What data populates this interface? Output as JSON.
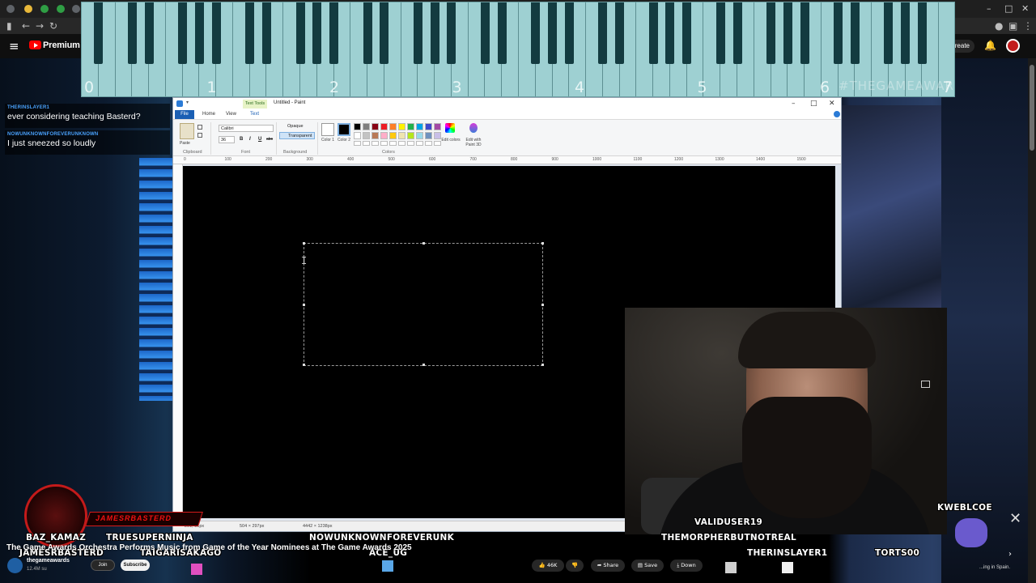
{
  "browser": {
    "window_controls": {
      "minimize": "–",
      "maximize": "□",
      "close": "✕"
    },
    "nav": {
      "back": "←",
      "forward": "→",
      "reload": "↻"
    }
  },
  "youtube_header": {
    "menu_icon": "≡",
    "brand_label": "Premium",
    "create_label": "Create",
    "bell_icon": "🔔"
  },
  "piano": {
    "octave_labels": [
      "0",
      "1",
      "2",
      "3",
      "4",
      "5",
      "6",
      "7"
    ],
    "watermark": "#THEGAMEAWARDS"
  },
  "chat": [
    {
      "user": "THERINSLAYER1",
      "message": "ever considering teaching Basterd?"
    },
    {
      "user": "NOWUNKNOWNFOREVERUNKNOWN",
      "message": "I just sneezed so loudly"
    }
  ],
  "paint": {
    "contextual_tab": "Text Tools",
    "title": "Untitled - Paint",
    "window_controls": {
      "minimize": "–",
      "maximize": "□",
      "close": "✕"
    },
    "tabs": [
      "File",
      "Home",
      "View",
      "Text"
    ],
    "clipboard_group": "Clipboard",
    "paste_label": "Paste",
    "font_group": "Font",
    "font_name": "Calibri",
    "font_size": "36",
    "format_buttons": [
      "B",
      "I",
      "U",
      "abc"
    ],
    "background_group": "Background",
    "background_options": [
      "Opaque",
      "Transparent"
    ],
    "color1_label": "Color 1",
    "color2_label": "Color 2",
    "colors_group": "Colors",
    "edit_colors": "Edit colors",
    "edit_paint3d": "Edit with Paint 3D",
    "ruler_marks": [
      "0",
      "100",
      "200",
      "300",
      "400",
      "500",
      "600",
      "700",
      "800",
      "900",
      "1000",
      "1100",
      "1200",
      "1300",
      "1400",
      "1500"
    ],
    "status": {
      "cursor": "291, 81px",
      "selection": "504 × 297px",
      "canvas": "4442 × 1238px"
    },
    "palette": [
      "#000000",
      "#7f7f7f",
      "#880015",
      "#ed1c24",
      "#ff7f27",
      "#fff200",
      "#22b14c",
      "#00a2e8",
      "#3f48cc",
      "#a349a4",
      "#ffffff",
      "#c3c3c3",
      "#b97a57",
      "#ffaec9",
      "#ffc90e",
      "#efe4b0",
      "#b5e61d",
      "#99d9ea",
      "#7092be",
      "#c8bfe7"
    ]
  },
  "stream": {
    "banner": "JAMESRBASTERD",
    "viewers": [
      "BAZ_KAMAZ",
      "TRUESUPERNINJA",
      "NOWUNKNOWNFOREVERUNK",
      "JAMESRBASTERD",
      "TAIGARISAKAGO",
      "ACE_UG",
      "VALIDUSER19",
      "THEMORPHERBUTNOTREAL",
      "THERINSLAYER1",
      "TORTS00",
      "KWEBLCOE"
    ]
  },
  "video": {
    "title": "The Game Awards Orchestra Performs Music from Game of the Year Nominees at The Game Awards 2025",
    "channel": "thegameawards",
    "subscribers": "12.4M su",
    "join": "Join",
    "subscribe": "Subscribe",
    "likes": "46K",
    "share": "Share",
    "save": "Save",
    "download": "Down",
    "recommendation": "...ing in Spain."
  }
}
